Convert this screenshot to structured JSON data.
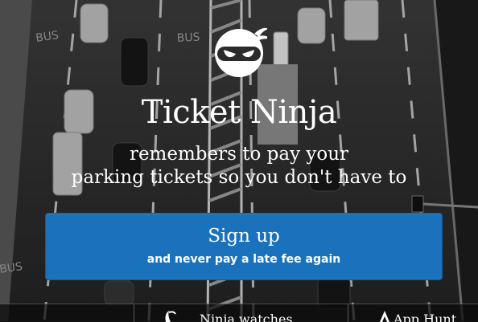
{
  "hero": {
    "app_name": "Ticket Ninja",
    "tagline_line1": "remembers to pay your",
    "tagline_line2": "parking tickets so you don't have to"
  },
  "signup": {
    "label": "Sign up",
    "sublabel": "and never pay a late fee again"
  },
  "road_markings": {
    "bus_label": "BUS"
  },
  "bottom_bar": {
    "items": [
      {
        "label": "",
        "icon": "blank"
      },
      {
        "label": "Ninja watches",
        "icon": "ninja-icon"
      },
      {
        "label": "App Hunt",
        "icon": "app-icon"
      }
    ]
  },
  "colors": {
    "accent": "#1a72bd",
    "background": "#2a2a2a",
    "text": "#ffffff"
  }
}
